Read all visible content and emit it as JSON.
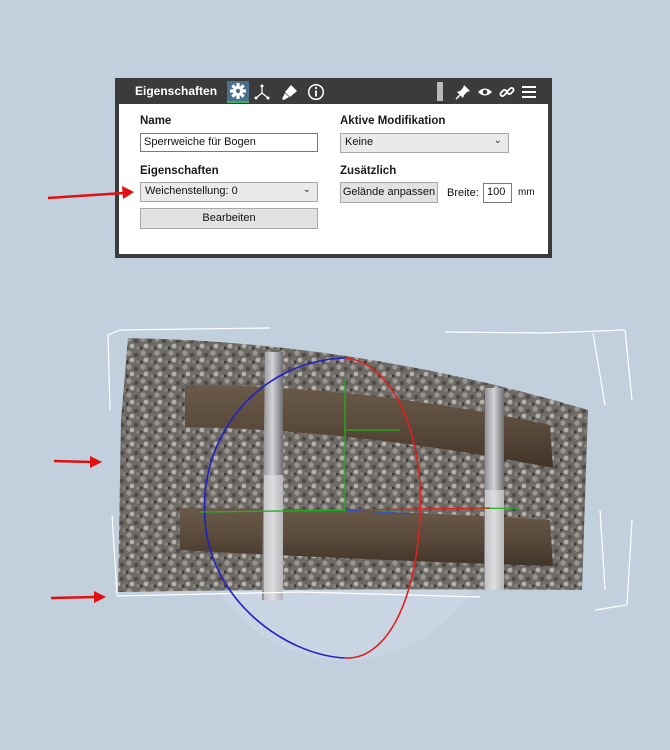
{
  "panel": {
    "title": "Eigenschaften",
    "tabs": [
      "settings",
      "transform",
      "paint",
      "info"
    ],
    "header_icons": [
      "pin-icon",
      "eye-icon",
      "link-icon",
      "menu-icon"
    ],
    "name_label": "Name",
    "name_value": "Sperrweiche für Bogen",
    "modification_label": "Aktive Modifikation",
    "modification_value": "Keine",
    "properties_label": "Eigenschaften",
    "properties_value": "Weichenstellung: 0",
    "edit_button": "Bearbeiten",
    "extra_label": "Zusätzlich",
    "terrain_button": "Gelände anpassen",
    "width_label": "Breite:",
    "width_value": "100",
    "width_unit": "mm"
  },
  "colors": {
    "panel_dark": "#3b3b3b",
    "active_tab": "#4a6f8f",
    "background": "#c2d0de",
    "arrow": "#e01010"
  }
}
